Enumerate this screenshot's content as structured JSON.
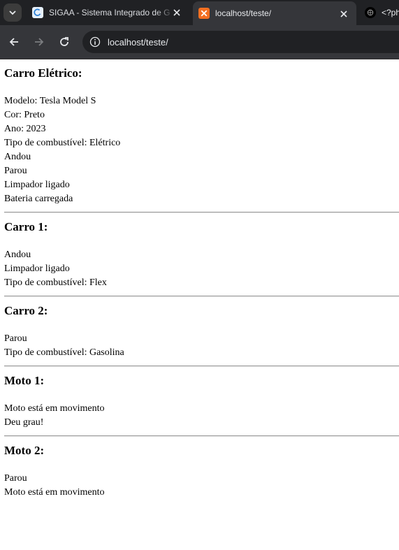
{
  "browser": {
    "tabs": [
      {
        "title": "SIGAA - Sistema Integrado de G",
        "favicon": "sigaa-icon"
      },
      {
        "title": "localhost/teste/",
        "favicon": "xampp-icon",
        "active": true
      },
      {
        "title": "<?ph",
        "favicon": "php-icon"
      }
    ],
    "url": "localhost/teste/"
  },
  "sections": [
    {
      "heading": "Carro Elétrico:",
      "lines": [
        "Modelo: Tesla Model S",
        "Cor: Preto",
        "Ano: 2023",
        "Tipo de combustível: Elétrico",
        "Andou",
        "Parou",
        "Limpador ligado",
        "Bateria carregada"
      ]
    },
    {
      "heading": "Carro 1:",
      "lines": [
        "Andou",
        "Limpador ligado",
        "Tipo de combustível: Flex"
      ]
    },
    {
      "heading": "Carro 2:",
      "lines": [
        "Parou",
        "Tipo de combustível: Gasolina"
      ]
    },
    {
      "heading": "Moto 1:",
      "lines": [
        "Moto está em movimento",
        "Deu grau!"
      ]
    },
    {
      "heading": "Moto 2:",
      "lines": [
        "Parou",
        "Moto está em movimento"
      ]
    }
  ]
}
